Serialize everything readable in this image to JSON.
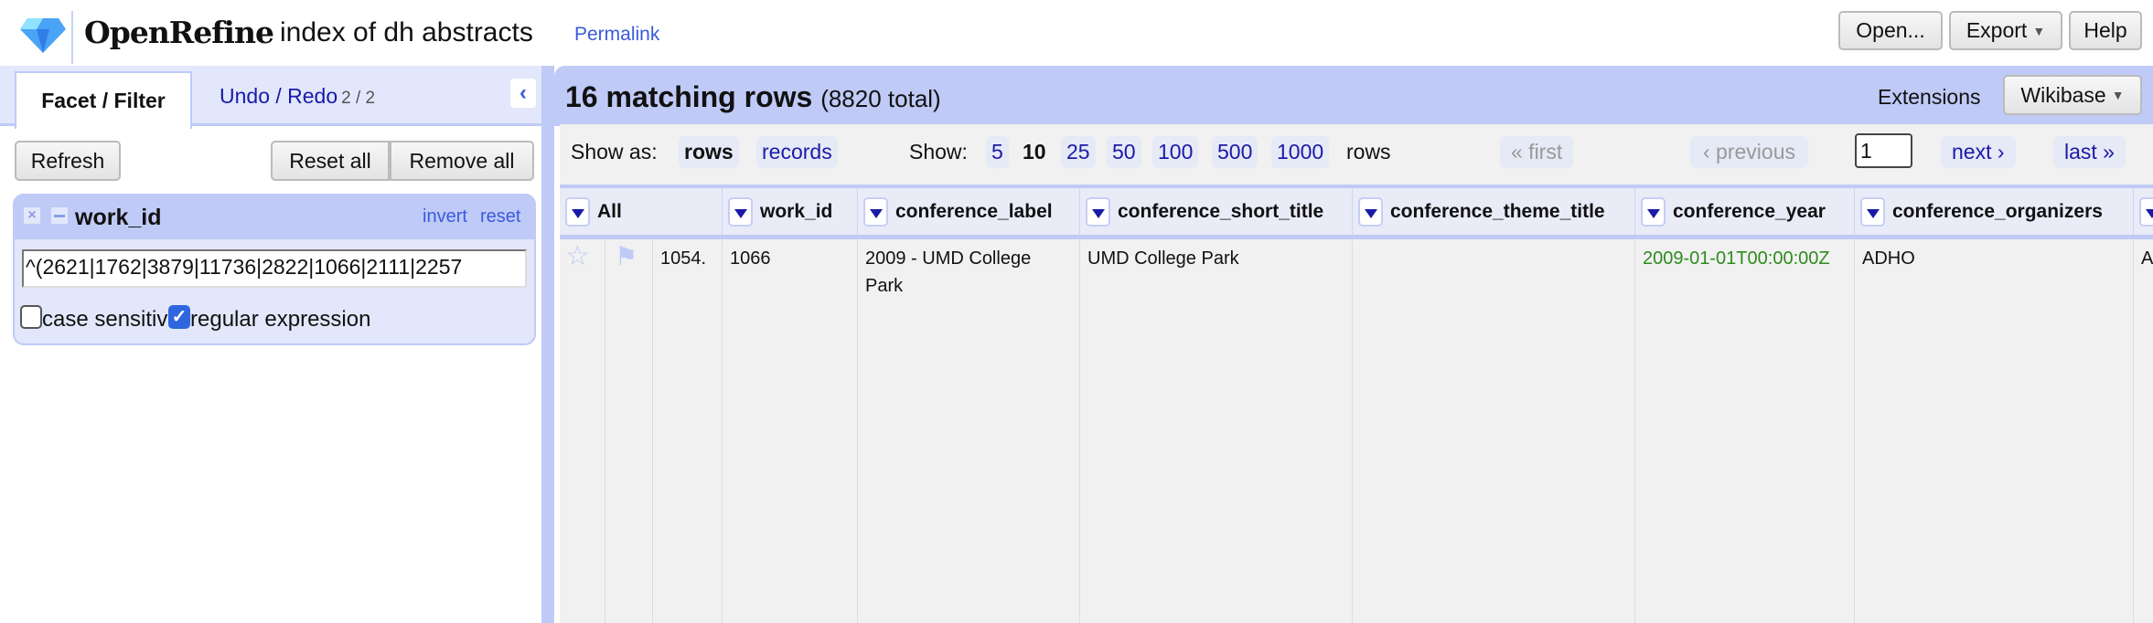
{
  "header": {
    "app_name": "OpenRefine",
    "project_name": "index of dh abstracts",
    "permalink": "Permalink",
    "buttons": {
      "open": "Open...",
      "export": "Export",
      "help": "Help"
    }
  },
  "left_panel": {
    "tabs": {
      "facet_filter": "Facet / Filter",
      "undo_redo": "Undo / Redo",
      "undo_count": "2 / 2"
    },
    "buttons": {
      "refresh": "Refresh",
      "reset_all": "Reset all",
      "remove_all": "Remove all"
    },
    "facet": {
      "title": "work_id",
      "invert": "invert",
      "reset": "reset",
      "value": "^(2621|1762|3879|11736|2822|1066|2111|2257",
      "case_sensitive": {
        "label": "case sensitive",
        "checked": false
      },
      "regular_expression": {
        "label": "regular expression",
        "checked": true
      }
    }
  },
  "main": {
    "summary": "16 matching rows",
    "summary_total": "(8820 total)",
    "extensions_label": "Extensions",
    "wikibase": "Wikibase",
    "show_as_label": "Show as:",
    "show_as": [
      {
        "label": "rows",
        "selected": true
      },
      {
        "label": "records",
        "selected": false
      }
    ],
    "show_label": "Show:",
    "page_sizes": [
      {
        "label": "5"
      },
      {
        "label": "10",
        "selected": true
      },
      {
        "label": "25"
      },
      {
        "label": "50"
      },
      {
        "label": "100"
      },
      {
        "label": "500"
      },
      {
        "label": "1000"
      }
    ],
    "rows_label": "rows",
    "pagination": {
      "first": "« first",
      "previous": "‹ previous",
      "page": "1",
      "next": "next ›",
      "last": "last »"
    },
    "columns": [
      "All",
      "work_id",
      "conference_label",
      "conference_short_title",
      "conference_theme_title",
      "conference_year",
      "conference_organizers",
      ""
    ],
    "rows": [
      {
        "row_number": "1054.",
        "cells": [
          "1066",
          "2009 - UMD College Park",
          "UMD College Park",
          "",
          "2009-01-01T00:00:00Z",
          "ADHO",
          "A"
        ]
      }
    ]
  },
  "colors": {
    "accent": "#bfcaf7",
    "link": "#1a1aa8",
    "date": "#2f8a1f"
  }
}
